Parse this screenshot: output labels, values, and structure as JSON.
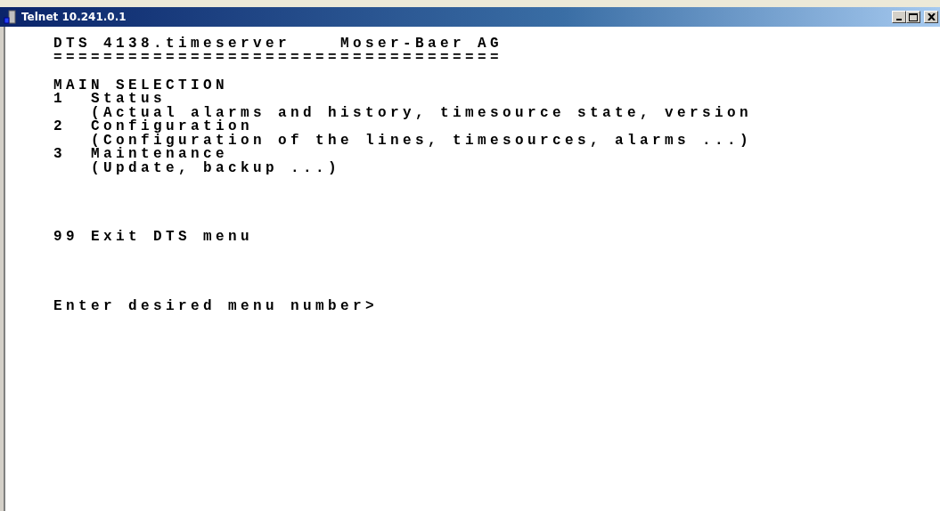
{
  "window": {
    "title": "Telnet 10.241.0.1"
  },
  "terminal": {
    "header": {
      "product": "DTS 4138.timeserver",
      "company": "Moser-Baer AG"
    },
    "separator": "====================================",
    "section_title": "MAIN SELECTION",
    "menu_items": [
      {
        "number": "1",
        "label": "Status",
        "description": "(Actual alarms and history, timesource state, version"
      },
      {
        "number": "2",
        "label": "Configuration",
        "description": "(Configuration of the lines, timesources, alarms ...)"
      },
      {
        "number": "3",
        "label": "Maintenance",
        "description": "(Update, backup ...)"
      }
    ],
    "exit_item": {
      "number": "99",
      "label": "Exit DTS menu"
    },
    "prompt": "Enter desired menu number>"
  }
}
